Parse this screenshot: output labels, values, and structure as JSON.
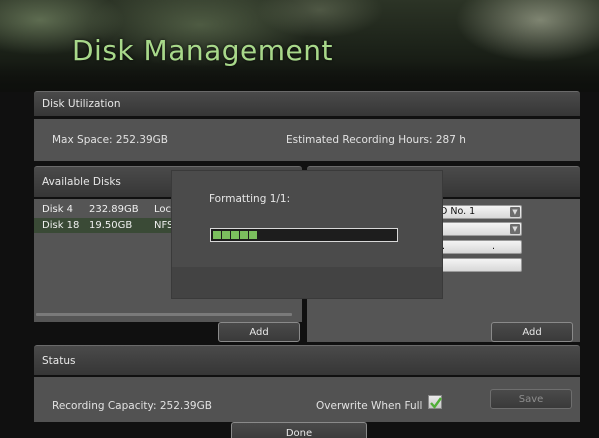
{
  "page": {
    "title": "Disk Management"
  },
  "utilization": {
    "header": "Disk Utilization",
    "max_space": "Max Space: 252.39GB",
    "estimated_hours": "Estimated Recording Hours: 287 h"
  },
  "available_disks": {
    "header": "Available Disks",
    "rows": [
      {
        "name": "Disk 4",
        "size": "232.89GB",
        "type": "Loc"
      },
      {
        "name": "Disk 18",
        "size": "19.50GB",
        "type": "NFS"
      }
    ],
    "add_label": "Add"
  },
  "right_panel": {
    "hdd_select": "D No. 1",
    "ip_dots": ". .",
    "add_label": "Add"
  },
  "modal": {
    "text": "Formatting 1/1:",
    "progress_segments": 5
  },
  "status": {
    "header": "Status",
    "capacity": "Recording Capacity: 252.39GB",
    "overwrite_label": "Overwrite When Full",
    "overwrite_checked": true,
    "save_label": "Save"
  },
  "footer": {
    "done_label": "Done"
  }
}
